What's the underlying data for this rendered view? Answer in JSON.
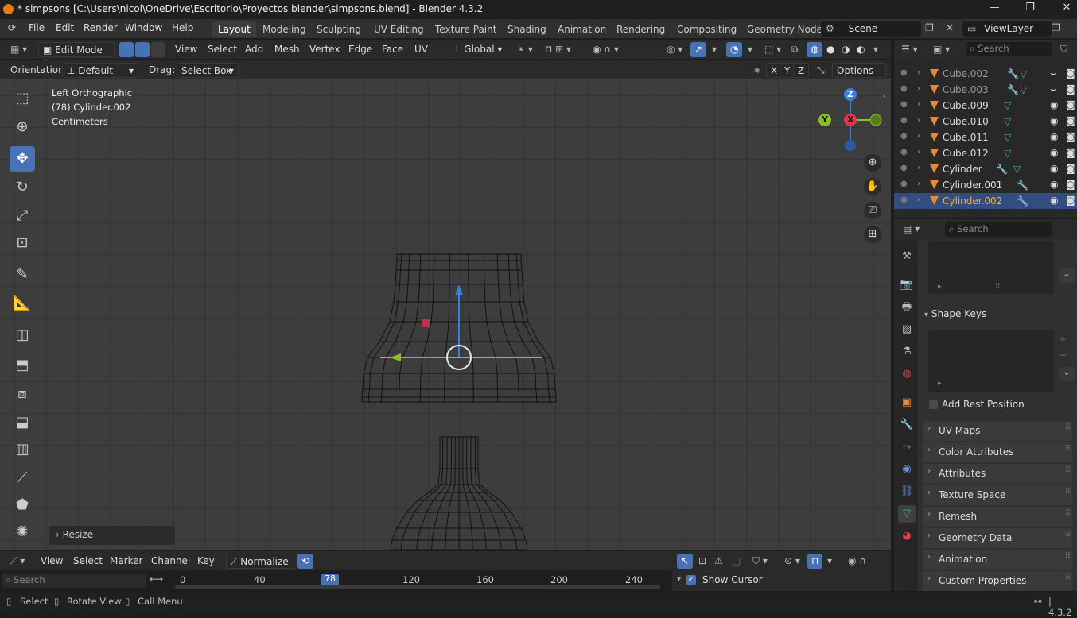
{
  "window": {
    "title": "* simpsons [C:\\Users\\nicol\\OneDrive\\Escritorio\\Proyectos blender\\simpsons.blend] - Blender 4.3.2",
    "minimize": "—",
    "maximize": "❐",
    "close": "✕"
  },
  "menu": {
    "file": "File",
    "edit": "Edit",
    "render": "Render",
    "window": "Window",
    "help": "Help"
  },
  "workspaces": [
    "Layout",
    "Modeling",
    "Sculpting",
    "UV Editing",
    "Texture Paint",
    "Shading",
    "Animation",
    "Rendering",
    "Compositing",
    "Geometry Node"
  ],
  "scene": {
    "name": "Scene",
    "view_layer": "ViewLayer"
  },
  "viewport_header": {
    "mode": "Edit Mode",
    "view": "View",
    "select": "Select",
    "add": "Add",
    "mesh": "Mesh",
    "vertex": "Vertex",
    "edge": "Edge",
    "face": "Face",
    "uv": "UV",
    "transform_orientation": "Global"
  },
  "tool_header": {
    "orientation_label": "Orientation:",
    "orientation_value": "Default",
    "drag_label": "Drag:",
    "drag_value": "Select Box",
    "x": "X",
    "y": "Y",
    "z": "Z",
    "options": "Options"
  },
  "viewport": {
    "view_name": "Left Orthographic",
    "object_info": "(78) Cylinder.002",
    "units": "Centimeters",
    "gizmo_z": "Z",
    "gizmo_y": "Y",
    "gizmo_x": "X",
    "last_operator": "Resize"
  },
  "outliner": {
    "search_placeholder": "Search",
    "items": [
      {
        "name": "Cube.002",
        "dim": true
      },
      {
        "name": "Cube.003",
        "dim": true
      },
      {
        "name": "Cube.009",
        "dim": false
      },
      {
        "name": "Cube.010",
        "dim": false
      },
      {
        "name": "Cube.011",
        "dim": false
      },
      {
        "name": "Cube.012",
        "dim": false
      },
      {
        "name": "Cylinder",
        "dim": false
      },
      {
        "name": "Cylinder.001",
        "dim": false
      },
      {
        "name": "Cylinder.002",
        "dim": false,
        "selected": true
      }
    ]
  },
  "properties": {
    "search_placeholder": "Search",
    "shape_keys": "Shape Keys",
    "add_rest_position": "Add Rest Position",
    "panels": [
      "UV Maps",
      "Color Attributes",
      "Attributes",
      "Texture Space",
      "Remesh",
      "Geometry Data",
      "Animation",
      "Custom Properties"
    ]
  },
  "timeline": {
    "view": "View",
    "select": "Select",
    "marker": "Marker",
    "channel": "Channel",
    "key": "Key",
    "normalize": "Normalize",
    "search_placeholder": "Search",
    "current_frame": "78",
    "ticks": [
      "0",
      "40",
      "120",
      "160",
      "200",
      "240"
    ],
    "show_cursor": "Show Cursor"
  },
  "statusbar": {
    "select": "Select",
    "rotate_view": "Rotate View",
    "call_menu": "Call Menu",
    "version": "4.3.2"
  },
  "colors": {
    "accent": "#4772b3",
    "selected_row": "#334d80",
    "object_orange": "#e38b3b",
    "mesh_green": "#3fb07a",
    "axis_x": "#e8344b",
    "axis_y": "#8cbf26",
    "axis_z": "#3b7fe0"
  }
}
